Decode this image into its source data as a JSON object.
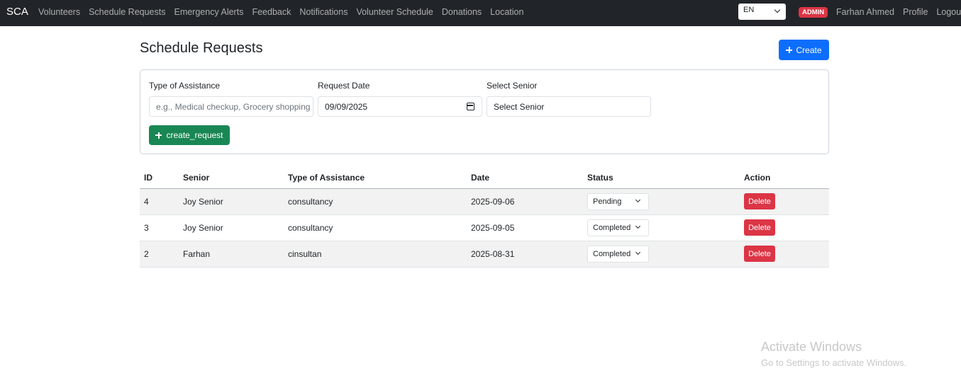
{
  "navbar": {
    "brand": "SCA",
    "links": [
      "Volunteers",
      "Schedule Requests",
      "Emergency Alerts",
      "Feedback",
      "Notifications",
      "Volunteer Schedule",
      "Donations",
      "Location"
    ],
    "language": "EN",
    "role_badge": "ADMIN",
    "user_name": "Farhan Ahmed",
    "profile_label": "Profile",
    "logout_label": "Logout"
  },
  "page": {
    "title": "Schedule Requests",
    "create_button": "Create"
  },
  "form": {
    "type_label": "Type of Assistance",
    "type_placeholder": "e.g., Medical checkup, Grocery shopping",
    "date_label": "Request Date",
    "date_value": "09/09/2025",
    "senior_label": "Select Senior",
    "senior_value": "Select Senior",
    "submit_button": "create_request"
  },
  "table": {
    "headers": [
      "ID",
      "Senior",
      "Type of Assistance",
      "Date",
      "Status",
      "Action"
    ],
    "rows": [
      {
        "id": "4",
        "senior": "Joy Senior",
        "type": "consultancy",
        "date": "2025-09-06",
        "status": "Pending",
        "action": "Delete"
      },
      {
        "id": "3",
        "senior": "Joy Senior",
        "type": "consultancy",
        "date": "2025-09-05",
        "status": "Completed",
        "action": "Delete"
      },
      {
        "id": "2",
        "senior": "Farhan",
        "type": "cinsultan",
        "date": "2025-08-31",
        "status": "Completed",
        "action": "Delete"
      }
    ]
  },
  "watermark": {
    "line1": "Activate Windows",
    "line2": "Go to Settings to activate Windows."
  },
  "colors": {
    "navbar": "#212529",
    "primary": "#0d6efd",
    "success": "#198754",
    "danger": "#dc3545"
  }
}
